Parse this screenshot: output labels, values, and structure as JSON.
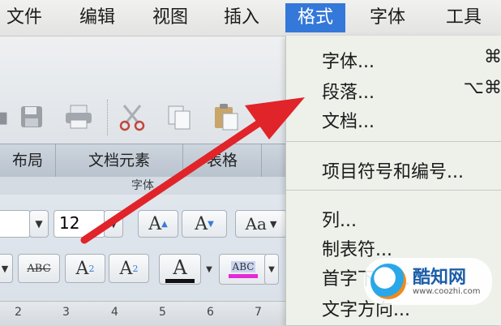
{
  "menubar": {
    "items": [
      {
        "label": "文件"
      },
      {
        "label": "编辑"
      },
      {
        "label": "视图"
      },
      {
        "label": "插入"
      },
      {
        "label": "格式"
      },
      {
        "label": "字体"
      },
      {
        "label": "工具"
      }
    ],
    "active": "格式"
  },
  "toolbar": {
    "icons": [
      "save-icon",
      "print-icon",
      "cut-icon",
      "copy-icon",
      "paste-icon"
    ]
  },
  "ribbon": {
    "tabs": [
      "布局",
      "文档元素",
      "表格"
    ],
    "group_label": "字体"
  },
  "font_controls": {
    "font_size": "12",
    "grow_label": "A",
    "shrink_label": "A",
    "superscript_label": "A",
    "superscript_mark": "2",
    "subscript_label": "A",
    "subscript_mark": "2",
    "strike_label": "ABC",
    "highlight_label": "ABC",
    "font_color_label": "A",
    "style_label": "Aa"
  },
  "ruler": {
    "ticks": [
      "2",
      "3",
      "4",
      "5",
      "6",
      "7"
    ]
  },
  "format_menu": {
    "items": [
      {
        "label": "字体...",
        "shortcut": "⌘"
      },
      {
        "label": "段落...",
        "shortcut": "⌥⌘"
      },
      {
        "label": "文档..."
      },
      {
        "label": "项目符号和编号..."
      },
      {
        "label": "列..."
      },
      {
        "label": "制表符..."
      },
      {
        "label": "首字下沉..."
      },
      {
        "label": "文字方向..."
      }
    ]
  },
  "watermark": {
    "name": "酷知网",
    "url": "www.coozhi.com"
  },
  "colors": {
    "menu_highlight": "#3478d9",
    "arrow": "#e0242a",
    "highlight_bar": "#e22ad8"
  }
}
